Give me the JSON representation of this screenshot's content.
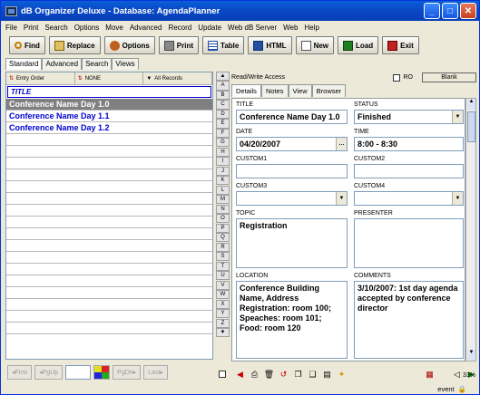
{
  "window": {
    "title": "dB Organizer Deluxe - Database: AgendaPlanner"
  },
  "menu": [
    "File",
    "Print",
    "Search",
    "Options",
    "Move",
    "Advanced",
    "Record",
    "Update",
    "Web dB Server",
    "Web",
    "Help"
  ],
  "toolbar": {
    "find": "Find",
    "replace": "Replace",
    "options": "Options",
    "print": "Print",
    "table": "Table",
    "html": "HTML",
    "new": "New",
    "load": "Load",
    "exit": "Exit"
  },
  "mode_tabs": [
    "Standard",
    "Advanced",
    "Search",
    "Views"
  ],
  "sort": {
    "entry_order": "Entry Order",
    "none": "NONE",
    "all_records": "All Records"
  },
  "list": {
    "header": "TITLE",
    "rows": [
      "Conference Name Day 1.0",
      "Conference Name Day 1.1",
      "Conference Name Day 1.2"
    ],
    "selected_index": 0
  },
  "alphabet": [
    "A",
    "B",
    "C",
    "D",
    "E",
    "F",
    "G",
    "H",
    "I",
    "J",
    "K",
    "L",
    "M",
    "N",
    "O",
    "P",
    "Q",
    "R",
    "S",
    "T",
    "U",
    "V",
    "W",
    "X",
    "Y",
    "Z"
  ],
  "nav": {
    "first": "First",
    "pgup": "PgUp",
    "pgdn": "PgDn",
    "last": "Last"
  },
  "access": {
    "mode": "Read/Write Access",
    "ro": "RO",
    "blank": "Blank"
  },
  "detail_tabs": [
    "Details",
    "Notes",
    "View",
    "Browser"
  ],
  "fields": {
    "title": {
      "label": "TITLE",
      "value": "Conference Name Day 1.0"
    },
    "status": {
      "label": "STATUS",
      "value": "Finished"
    },
    "date": {
      "label": "DATE",
      "value": "04/20/2007"
    },
    "time": {
      "label": "TIME",
      "value": "8:00 - 8:30"
    },
    "custom1": {
      "label": "CUSTOM1",
      "value": ""
    },
    "custom2": {
      "label": "CUSTOM2",
      "value": ""
    },
    "custom3": {
      "label": "CUSTOM3",
      "value": ""
    },
    "custom4": {
      "label": "CUSTOM4",
      "value": ""
    },
    "topic": {
      "label": "TOPIC",
      "value": "Registration"
    },
    "presenter": {
      "label": "PRESENTER",
      "value": ""
    },
    "location": {
      "label": "LOCATION",
      "value": "Conference Building Name, Address Registration: room 100; Speaches: room 101; Food: room 120"
    },
    "comments": {
      "label": "COMMENTS",
      "value": "3/10/2007: 1st day agenda accepted by conference director"
    }
  },
  "status": {
    "zoom": "33%",
    "event": "event"
  }
}
